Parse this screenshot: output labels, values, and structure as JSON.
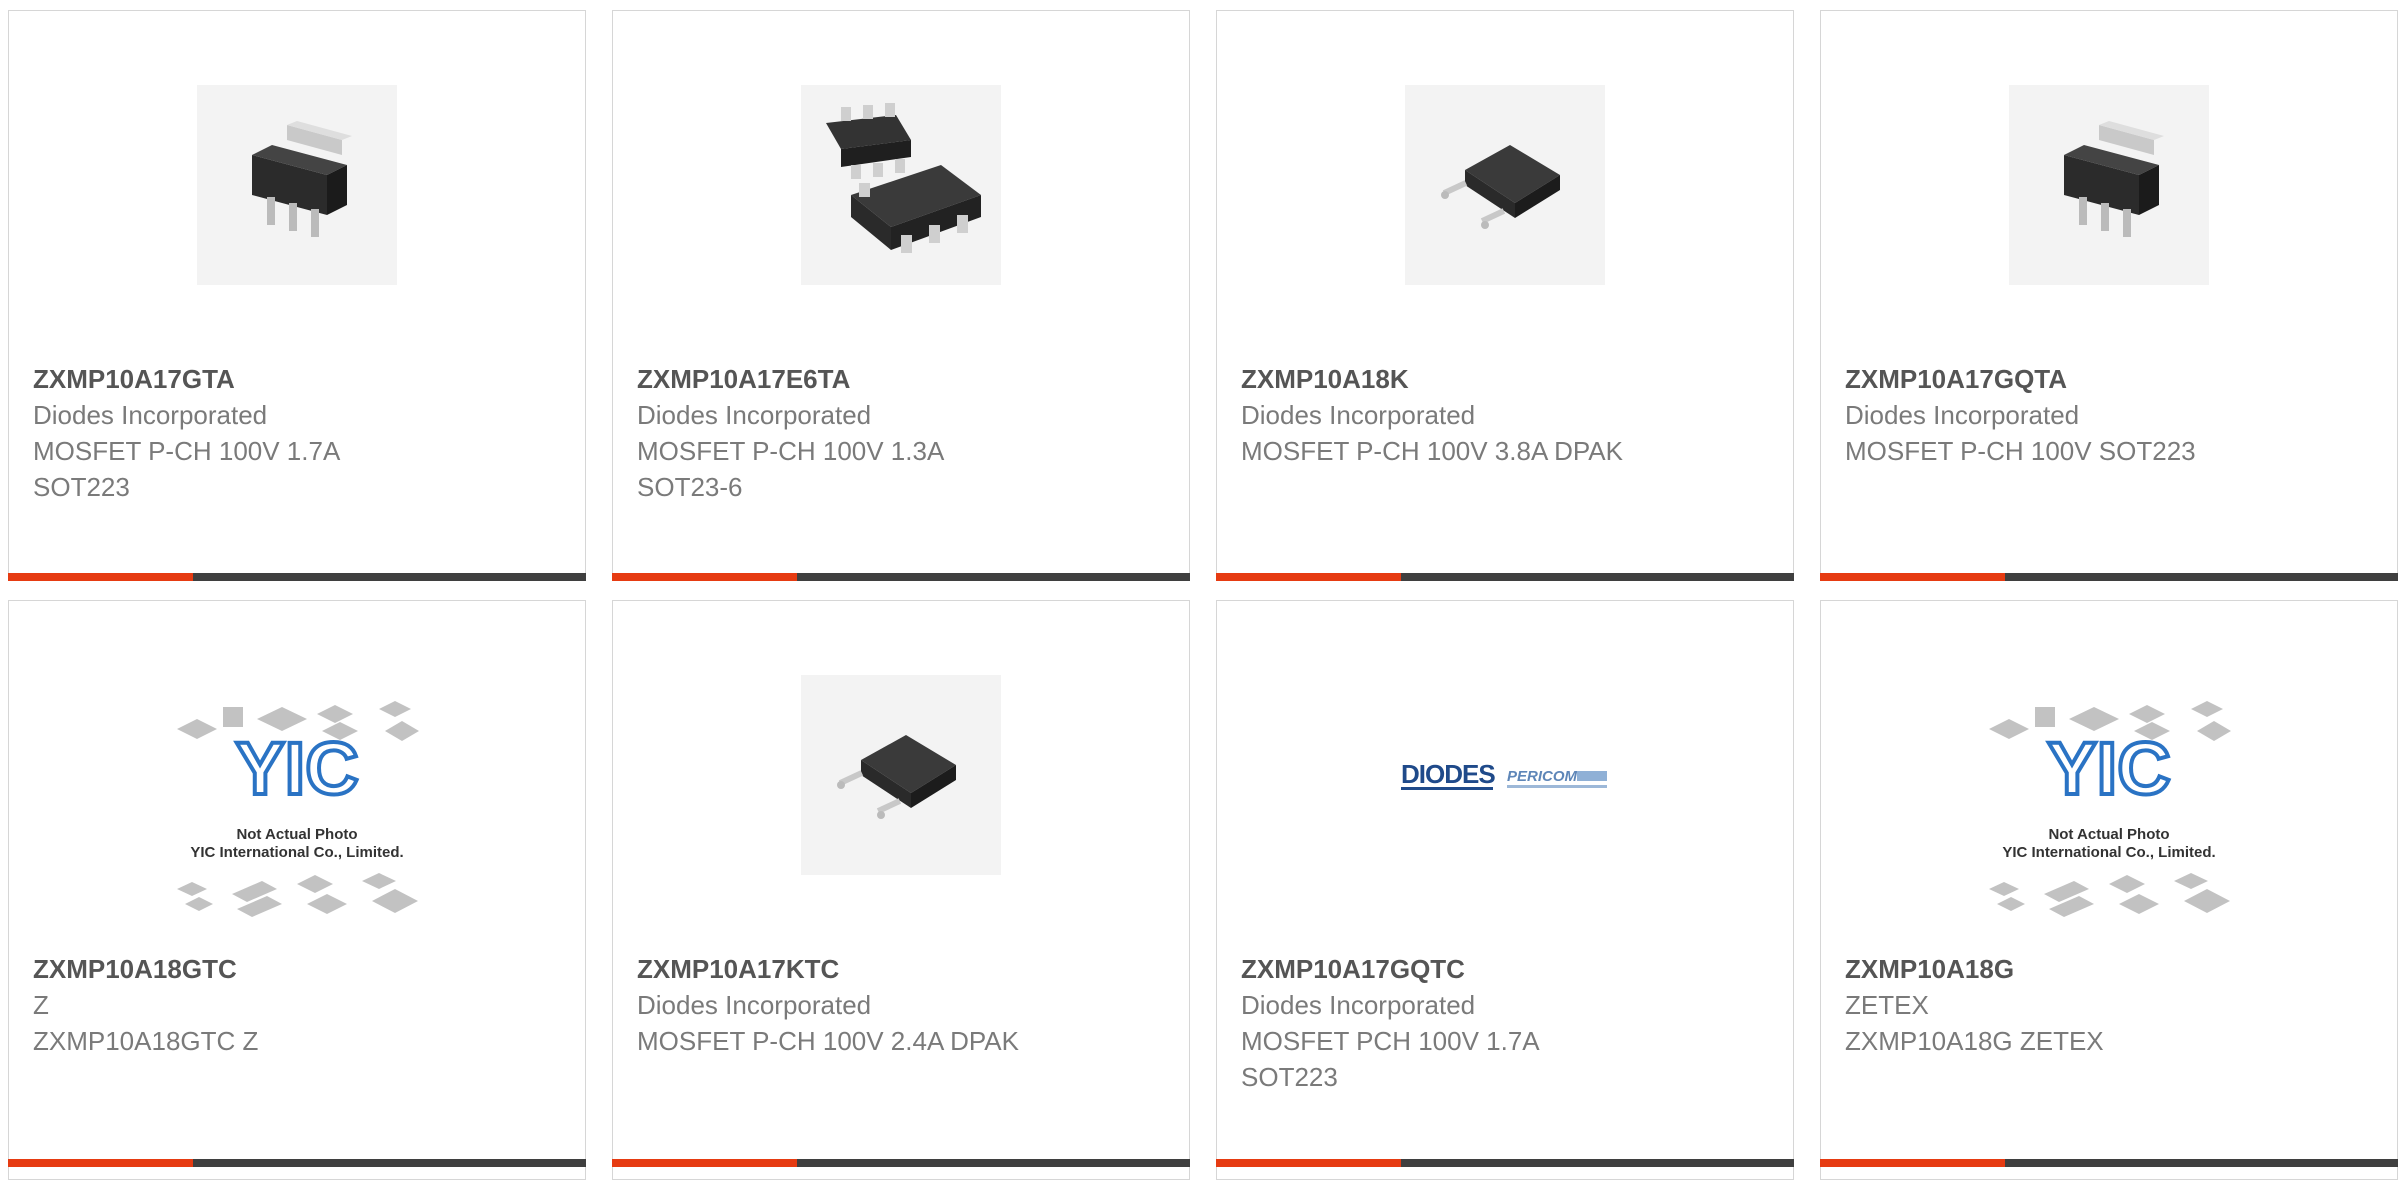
{
  "accent_color": "#e63b12",
  "bar_color": "#3f3f3f",
  "products": [
    {
      "part_number": "ZXMP10A17GTA",
      "manufacturer": "Diodes Incorporated",
      "description": "MOSFET P-CH 100V 1.7A\nSOT223",
      "image_icon": "sot223-package-icon"
    },
    {
      "part_number": "ZXMP10A17E6TA",
      "manufacturer": "Diodes Incorporated",
      "description": "MOSFET P-CH 100V 1.3A\nSOT23-6",
      "image_icon": "sot23-6-package-icon"
    },
    {
      "part_number": "ZXMP10A18K",
      "manufacturer": "Diodes Incorporated",
      "description": "MOSFET P-CH 100V 3.8A DPAK",
      "image_icon": "dpak-package-icon"
    },
    {
      "part_number": "ZXMP10A17GQTA",
      "manufacturer": "Diodes Incorporated",
      "description": "MOSFET P-CH 100V SOT223",
      "image_icon": "sot223-package-icon"
    },
    {
      "part_number": "ZXMP10A18GTC",
      "manufacturer": "Z",
      "description": "ZXMP10A18GTC Z",
      "image_icon": "not-actual-photo-icon"
    },
    {
      "part_number": "ZXMP10A17KTC",
      "manufacturer": "Diodes Incorporated",
      "description": "MOSFET P-CH 100V 2.4A DPAK",
      "image_icon": "dpak-package-icon"
    },
    {
      "part_number": "ZXMP10A17GQTC",
      "manufacturer": "Diodes Incorporated",
      "description": "MOSFET PCH 100V 1.7A\nSOT223",
      "image_icon": "diodes-pericom-logo-icon"
    },
    {
      "part_number": "ZXMP10A18G",
      "manufacturer": "ZETEX",
      "description": "ZXMP10A18G ZETEX",
      "image_icon": "not-actual-photo-icon"
    }
  ]
}
